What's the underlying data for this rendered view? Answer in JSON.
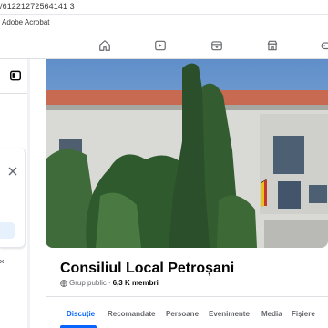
{
  "browser": {
    "address_text": "/61221272564141 3",
    "bookmark": "Adobe Acrobat"
  },
  "nav": {
    "icons": [
      "home-icon",
      "video-icon",
      "marketplace-icon",
      "store-icon",
      "gaming-icon"
    ]
  },
  "group": {
    "name": "Consiliul Local Petroșani",
    "privacy": "Grup public",
    "separator": "·",
    "members": "6,3 K membri"
  },
  "tabs": [
    {
      "label": "Discuție",
      "active": true
    },
    {
      "label": "Recomandate",
      "active": false
    },
    {
      "label": "Persoane",
      "active": false
    },
    {
      "label": "Evenimente",
      "active": false
    },
    {
      "label": "Media",
      "active": false
    },
    {
      "label": "Fișiere",
      "active": false
    }
  ],
  "colors": {
    "accent": "#0866ff",
    "text_primary": "#050505",
    "text_secondary": "#65676b"
  }
}
